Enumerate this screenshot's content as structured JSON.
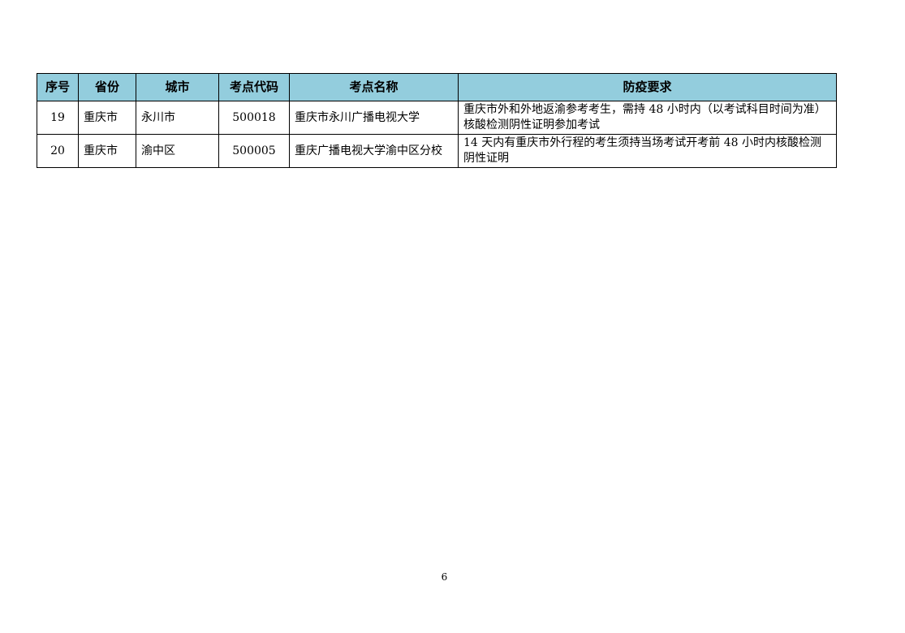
{
  "table": {
    "headers": [
      "序号",
      "省份",
      "城市",
      "考点代码",
      "考点名称",
      "防疫要求"
    ],
    "rows": [
      {
        "index": "19",
        "province": "重庆市",
        "city": "永川市",
        "code": "500018",
        "name": "重庆市永川广播电视大学",
        "requirement": "重庆市外和外地返渝参考考生，需持 48 小时内（以考试科目时间为准）核酸检测阴性证明参加考试"
      },
      {
        "index": "20",
        "province": "重庆市",
        "city": "渝中区",
        "code": "500005",
        "name": "重庆广播电视大学渝中区分校",
        "requirement": "14 天内有重庆市外行程的考生须持当场考试开考前 48 小时内核酸检测阴性证明"
      }
    ]
  },
  "footer": {
    "page_number": "6"
  },
  "colors": {
    "header_background": "#93cddd"
  }
}
